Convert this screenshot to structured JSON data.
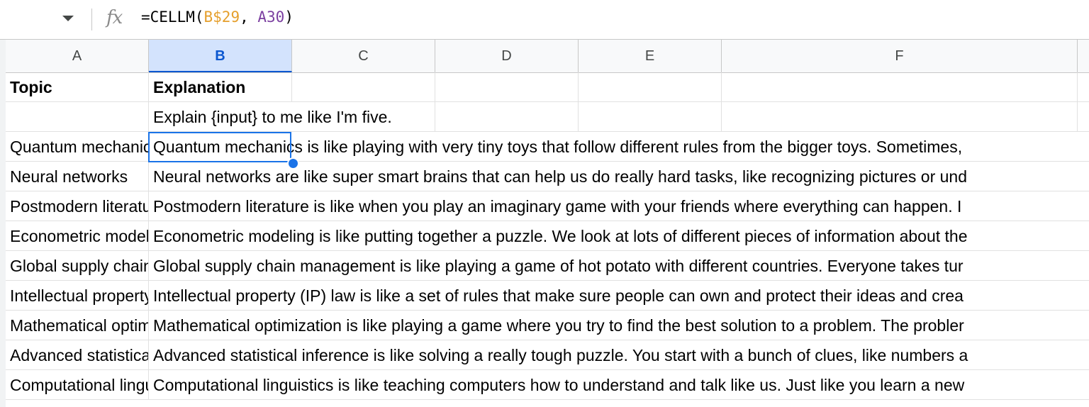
{
  "formula_bar": {
    "fx_label": "fx",
    "formula_prefix": "=CELLM(",
    "formula_ref1": "B$29",
    "formula_sep": ", ",
    "formula_ref2": "A30",
    "formula_suffix": ")"
  },
  "columns": [
    "A",
    "B",
    "C",
    "D",
    "E",
    "F"
  ],
  "selected_column": "B",
  "rows": [
    {
      "a": "Topic",
      "b": "Explanation",
      "bold": true
    },
    {
      "a": "",
      "b": "Explain {input} to me like I'm five.",
      "bold": false
    },
    {
      "a": "Quantum mechanics",
      "b": "Quantum mechanics is like playing with very tiny toys that follow different rules from the bigger toys. Sometimes,",
      "bold": false
    },
    {
      "a": "Neural networks",
      "b": "Neural networks are like super smart brains that can help us do really hard tasks, like recognizing pictures or und",
      "bold": false
    },
    {
      "a": "Postmodern literature",
      "b": "Postmodern literature is like when you play an imaginary game with your friends where everything can happen. I",
      "bold": false
    },
    {
      "a": "Econometric modeling",
      "b": "Econometric modeling is like putting together a puzzle. We look at lots of different pieces of information about the",
      "bold": false
    },
    {
      "a": "Global supply chain management",
      "b": "Global supply chain management is like playing a game of hot potato with different countries. Everyone takes tur",
      "bold": false
    },
    {
      "a": "Intellectual property law",
      "b": "Intellectual property (IP) law is like a set of rules that make sure people can own and protect their ideas and crea",
      "bold": false
    },
    {
      "a": "Mathematical optimization",
      "b": "Mathematical optimization is like playing a game where you try to find the best solution to a problem. The probler",
      "bold": false
    },
    {
      "a": "Advanced statistical inference",
      "b": "Advanced statistical inference is like solving a really tough puzzle. You start with a bunch of clues, like numbers a",
      "bold": false
    },
    {
      "a": "Computational linguistics",
      "b": "Computational linguistics is like teaching computers how to understand and talk like us. Just like you learn a new",
      "bold": false
    }
  ]
}
